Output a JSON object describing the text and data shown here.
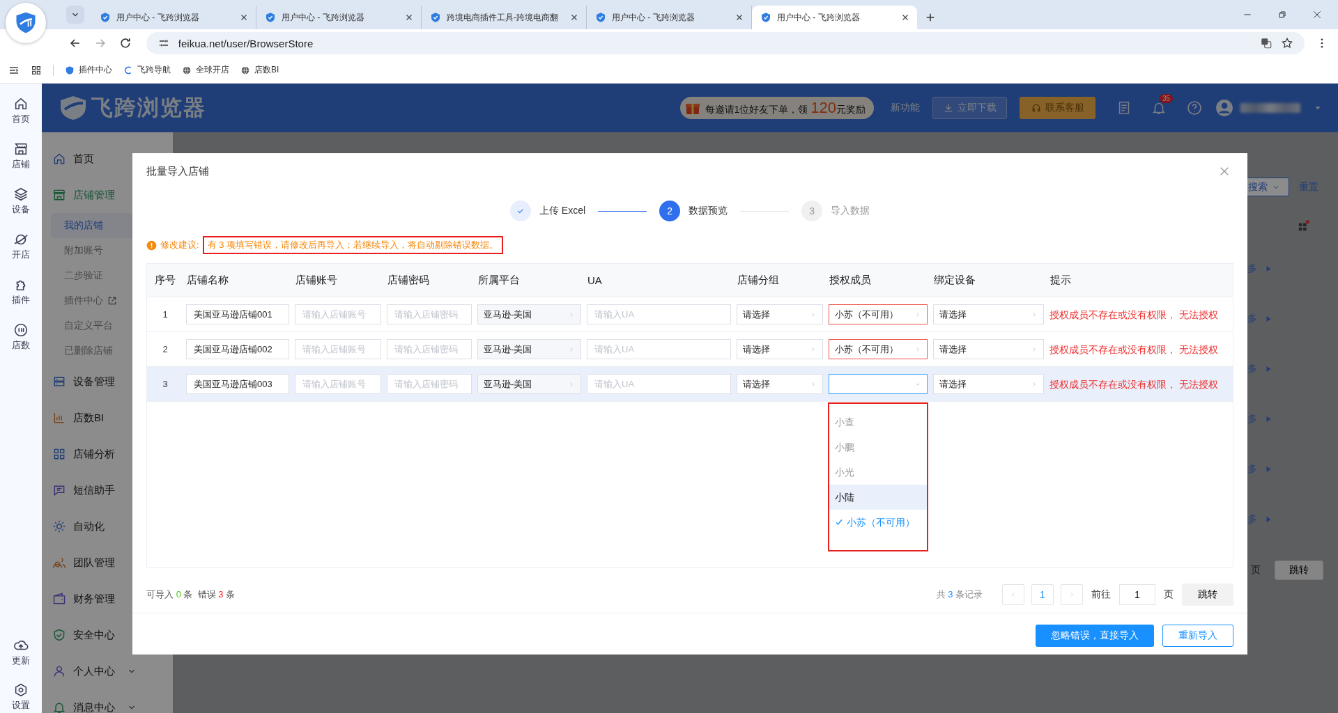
{
  "browser": {
    "tabs": [
      {
        "title": "用户中心 - 飞跨浏览器",
        "selected": false
      },
      {
        "title": "用户中心 - 飞跨浏览器",
        "selected": false
      },
      {
        "title": "跨境电商插件工具-跨境电商翻",
        "selected": false
      },
      {
        "title": "用户中心 - 飞跨浏览器",
        "selected": false
      },
      {
        "title": "用户中心 - 飞跨浏览器",
        "selected": true
      }
    ],
    "url": "feikua.net/user/BrowserStore",
    "bookmarks": [
      "插件中心",
      "飞跨导航",
      "全球开店",
      "店数BI"
    ]
  },
  "rail": {
    "items": [
      "首页",
      "店铺",
      "设备",
      "开店",
      "插件",
      "店数"
    ],
    "bottom_items": [
      "更新",
      "设置"
    ]
  },
  "header": {
    "logo_text": "飞跨浏览器",
    "promo_before": "每邀请1位好友下单，领",
    "promo_amount": "120",
    "promo_after": "元奖励",
    "new_feature": "新功能",
    "download": "立即下载",
    "support": "联系客服",
    "notification_count": "35"
  },
  "sidebar": {
    "items": [
      {
        "label": "首页",
        "selected": false,
        "collapsed": false
      },
      {
        "label": "店铺管理",
        "selected": true,
        "collapsed": false,
        "children": [
          {
            "label": "我的店铺",
            "selected": true,
            "external": false
          },
          {
            "label": "附加账号",
            "selected": false,
            "external": false
          },
          {
            "label": "二步验证",
            "selected": false,
            "external": false
          },
          {
            "label": "插件中心",
            "selected": false,
            "external": true
          },
          {
            "label": "自定义平台",
            "selected": false,
            "external": false
          },
          {
            "label": "已删除店铺",
            "selected": false,
            "external": false
          }
        ]
      },
      {
        "label": "设备管理",
        "selected": false,
        "collapsed": false
      },
      {
        "label": "店数BI",
        "selected": false,
        "collapsed": false
      },
      {
        "label": "店铺分析",
        "selected": false,
        "collapsed": false
      },
      {
        "label": "短信助手",
        "selected": false,
        "collapsed": false
      },
      {
        "label": "自动化",
        "selected": false,
        "collapsed": false
      },
      {
        "label": "团队管理",
        "selected": false,
        "collapsed": false
      },
      {
        "label": "财务管理",
        "selected": false,
        "collapsed": false
      },
      {
        "label": "安全中心",
        "selected": false,
        "collapsed": false
      },
      {
        "label": "个人中心",
        "selected": false,
        "collapsed": true
      },
      {
        "label": "消息中心",
        "selected": false,
        "collapsed": true
      }
    ]
  },
  "background": {
    "search": "搜索",
    "reset": "重置",
    "more_links": [
      "多",
      "多",
      "多",
      "多",
      "多",
      "多"
    ],
    "pager_unit": "页",
    "jump": "跳转"
  },
  "modal": {
    "title": "批量导入店铺",
    "steps": [
      {
        "label": "上传 Excel",
        "completed": true,
        "selected": false
      },
      {
        "number": "2",
        "label": "数据预览",
        "completed": false,
        "selected": true
      },
      {
        "number": "3",
        "label": "导入数据",
        "completed": false,
        "selected": false
      }
    ],
    "warning_label": "修改建议:",
    "warning": "有 3 项填写错误，请修改后再导入；若继续导入，将自动剔除错误数据。",
    "columns": [
      "序号",
      "店铺名称",
      "店铺账号",
      "店铺密码",
      "所属平台",
      "UA",
      "店铺分组",
      "授权成员",
      "绑定设备",
      "提示"
    ],
    "rows": [
      {
        "index": "1",
        "name": "美国亚马逊店铺001",
        "account_placeholder": "请输入店铺账号",
        "password_placeholder": "请输入店铺密码",
        "platform": "亚马逊-美国",
        "ua_placeholder": "请输入UA",
        "group": "请选择",
        "member": "小苏（不可用）",
        "member_error": true,
        "member_focused": false,
        "device": "请选择",
        "hint": "授权成员不存在或没有权限， 无法授权",
        "highlighted": false
      },
      {
        "index": "2",
        "name": "美国亚马逊店铺002",
        "account_placeholder": "请输入店铺账号",
        "password_placeholder": "请输入店铺密码",
        "platform": "亚马逊-美国",
        "ua_placeholder": "请输入UA",
        "group": "请选择",
        "member": "小苏（不可用）",
        "member_error": true,
        "member_focused": false,
        "device": "请选择",
        "hint": "授权成员不存在或没有权限， 无法授权",
        "highlighted": false
      },
      {
        "index": "3",
        "name": "美国亚马逊店铺003",
        "account_placeholder": "请输入店铺账号",
        "password_placeholder": "请输入店铺密码",
        "platform": "亚马逊-美国",
        "ua_placeholder": "请输入UA",
        "group": "请选择",
        "member_error": false,
        "member_focused": true,
        "device": "请选择",
        "hint": "授权成员不存在或没有权限， 无法授权",
        "highlighted": true
      }
    ],
    "member_options": [
      {
        "label": "小查",
        "disabled": true,
        "hovered": false,
        "selected": false
      },
      {
        "label": "小鹏",
        "disabled": true,
        "hovered": false,
        "selected": false
      },
      {
        "label": "小光",
        "disabled": true,
        "hovered": false,
        "selected": false
      },
      {
        "label": "小陆",
        "disabled": false,
        "hovered": true,
        "selected": false
      },
      {
        "label": "小苏（不可用）",
        "disabled": false,
        "hovered": false,
        "selected": true
      }
    ],
    "summary": {
      "importable_label": "可导入",
      "importable": "0",
      "unit_1": "条",
      "error_label": "错误",
      "errors": "3",
      "unit_2": "条"
    },
    "pagination": {
      "total_before": "共",
      "total": "3",
      "total_after": "条记录",
      "page": "1",
      "goto_label": "前往",
      "goto_value": "1",
      "page_unit": "页",
      "jump": "跳转"
    },
    "buttons": {
      "primary": "忽略错误，直接导入",
      "secondary": "重新导入"
    }
  }
}
